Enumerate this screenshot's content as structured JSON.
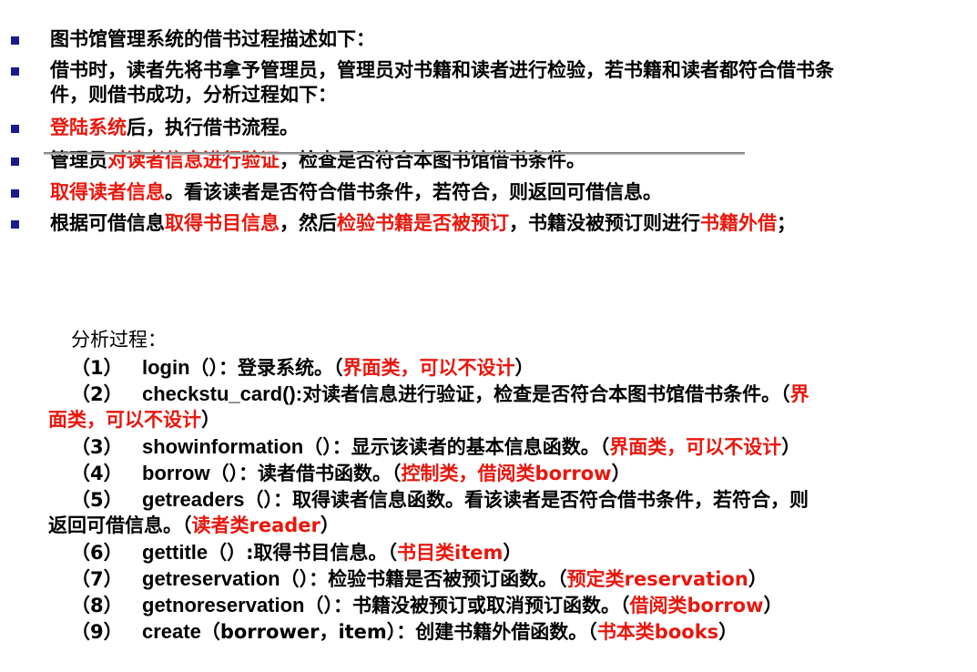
{
  "bullets": [
    [
      {
        "t": "图书馆管理系统的借书过程描述如下：",
        "c": "black"
      }
    ],
    [
      {
        "t": "借书时，读者先将书拿予管理员，管理员对书籍和读者进行检验，若书籍和读者都符合借书条",
        "c": "black"
      }
    ],
    [
      {
        "t": "件，则借书成功，分析过程如下：",
        "c": "black"
      }
    ],
    [
      {
        "t": "登陆系统",
        "c": "red"
      },
      {
        "t": "后，执行借书流程。",
        "c": "black"
      }
    ],
    [
      {
        "t": "管理员",
        "c": "black"
      },
      {
        "t": "对读者信息进行验证",
        "c": "red"
      },
      {
        "t": "，检查是否符合本图书馆借书条件。",
        "c": "black"
      }
    ],
    [
      {
        "t": "取得读者信息",
        "c": "red"
      },
      {
        "t": "。看该读者是否符合借书条件，若符合，则返回可借信息。",
        "c": "black"
      }
    ],
    [
      {
        "t": "根据可借信息",
        "c": "black"
      },
      {
        "t": "取得书目信息",
        "c": "red"
      },
      {
        "t": "，然后",
        "c": "black"
      },
      {
        "t": "检验书籍是否被预订",
        "c": "red"
      },
      {
        "t": "，书籍没被预订则进行",
        "c": "black"
      },
      {
        "t": "书籍外借",
        "c": "red"
      },
      {
        "t": "；",
        "c": "black"
      }
    ]
  ],
  "analysis_title": "分析过程：",
  "analysis_lines": [
    {
      "num": "（1）",
      "fn": "login",
      "rest": [
        {
          "t": "（）：登录系统。（",
          "c": "black"
        },
        {
          "t": "界面类，可以不设计",
          "c": "red"
        },
        {
          "t": "）",
          "c": "black"
        }
      ]
    },
    {
      "num": "（2）",
      "fn": "checkstu_card():",
      "rest": [
        {
          "t": "对读者信息进行验证，检查是否符合本图书馆借书条件。（",
          "c": "black"
        },
        {
          "t": "界",
          "c": "red"
        }
      ]
    },
    {
      "num": "",
      "fn": "",
      "cont": true,
      "rest": [
        {
          "t": "面类，可以不设计",
          "c": "red"
        },
        {
          "t": "）",
          "c": "black"
        }
      ]
    },
    {
      "num": "（3）",
      "fn": "showinformation",
      "rest": [
        {
          "t": "（）：显示该读者的基本信息函数。（",
          "c": "black"
        },
        {
          "t": "界面类，可以不设计",
          "c": "red"
        },
        {
          "t": "）",
          "c": "black"
        }
      ]
    },
    {
      "num": "（4）",
      "fn": "borrow",
      "rest": [
        {
          "t": "（）：读者借书函数。（",
          "c": "black"
        },
        {
          "t": "控制类，借阅类borrow",
          "c": "red"
        },
        {
          "t": "）",
          "c": "black"
        }
      ]
    },
    {
      "num": "（5）",
      "fn": "getreaders",
      "rest": [
        {
          "t": "（）：取得读者信息函数。看该读者是否符合借书条件，若符合，则",
          "c": "black"
        }
      ]
    },
    {
      "num": "",
      "fn": "",
      "cont": true,
      "rest": [
        {
          "t": "返回可借信息。（",
          "c": "black"
        },
        {
          "t": "读者类reader",
          "c": "red"
        },
        {
          "t": "）",
          "c": "black"
        }
      ]
    },
    {
      "num": "（6）",
      "fn": "gettitle",
      "rest": [
        {
          "t": "（）:取得书目信息。（",
          "c": "black"
        },
        {
          "t": "书目类item",
          "c": "red"
        },
        {
          "t": "）",
          "c": "black"
        }
      ]
    },
    {
      "num": "（7）",
      "fn": "getreservation",
      "rest": [
        {
          "t": "（）：检验书籍是否被预订函数。（",
          "c": "black"
        },
        {
          "t": "预定类reservation",
          "c": "red"
        },
        {
          "t": "）",
          "c": "black"
        }
      ]
    },
    {
      "num": "（8）",
      "fn": "getnoreservation",
      "rest": [
        {
          "t": "（）：书籍没被预订或取消预订函数。（",
          "c": "black"
        },
        {
          "t": "借阅类borrow",
          "c": "red"
        },
        {
          "t": "）",
          "c": "black"
        }
      ]
    },
    {
      "num": "（9）",
      "fn": "create",
      "rest": [
        {
          "t": "（borrower，item）：创建书籍外借函数。（",
          "c": "black"
        },
        {
          "t": "书本类books",
          "c": "red"
        },
        {
          "t": "）",
          "c": "black"
        }
      ]
    }
  ],
  "colors": {
    "red": "#e8170d",
    "bullet": "#1a1a8c",
    "text": "#000000"
  }
}
